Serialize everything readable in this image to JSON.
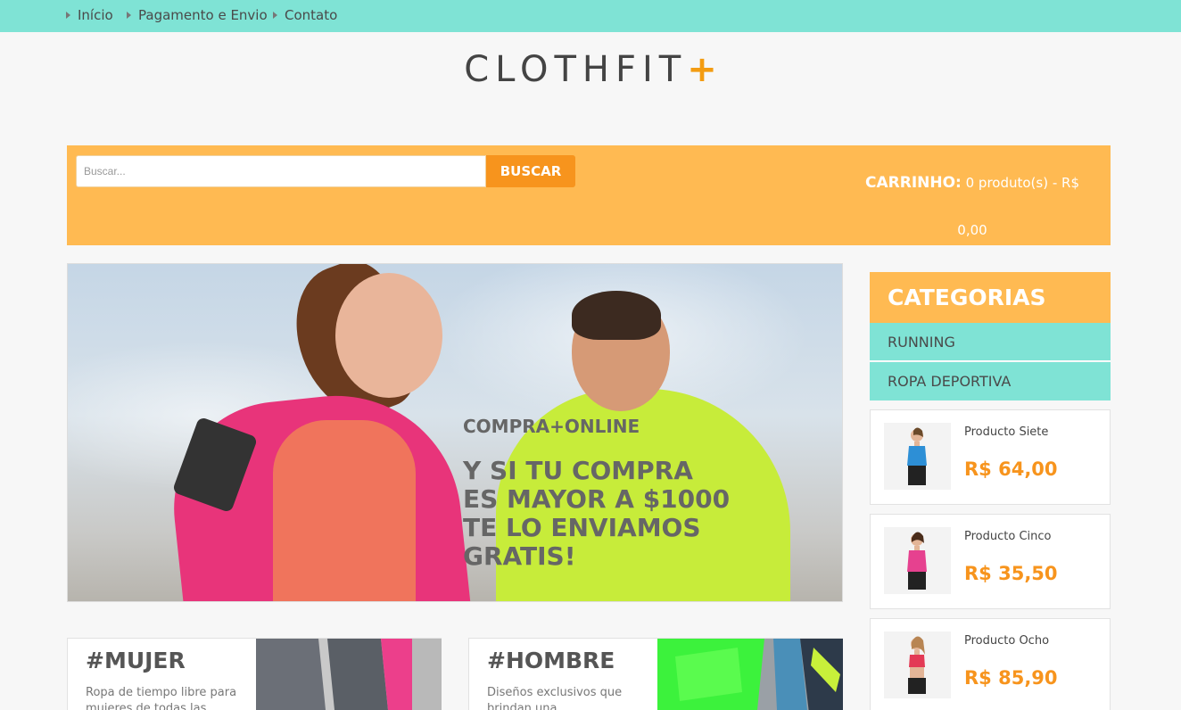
{
  "nav": {
    "items": [
      {
        "label": "Início"
      },
      {
        "label": "Pagamento e Envio"
      },
      {
        "label": "Contato"
      }
    ]
  },
  "logo": {
    "text": "CLOTHFIT",
    "accent": "+"
  },
  "search": {
    "placeholder": "Buscar...",
    "button": "BUSCAR"
  },
  "cart": {
    "label": "CARRINHO:",
    "summary": "0 produto(s) - R$",
    "total": "0,00"
  },
  "banner": {
    "kicker": "COMPRA+ONLINE",
    "message": "Y SI TU COMPRA ES MAYOR A $1000 TE LO ENVIAMOS GRATIS!"
  },
  "sidebar": {
    "title": "CATEGORIAS",
    "categories": [
      {
        "label": "RUNNING"
      },
      {
        "label": "ROPA DEPORTIVA"
      }
    ],
    "products": [
      {
        "name": "Producto Siete",
        "price": "R$ 64,00",
        "top_color": "#2d8fd6"
      },
      {
        "name": "Producto Cinco",
        "price": "R$ 35,50",
        "top_color": "#e6418f"
      },
      {
        "name": "Producto Ocho",
        "price": "R$ 85,90",
        "top_color": "#e33a55"
      }
    ]
  },
  "cards": [
    {
      "title": "#MUJER",
      "desc": "Ropa de tiempo libre para mujeres de todas las"
    },
    {
      "title": "#HOMBRE",
      "desc": "Diseños exclusivos que brindan una"
    }
  ],
  "colors": {
    "teal": "#7fe3d5",
    "orange": "#ffba52",
    "accent": "#f7941d"
  }
}
